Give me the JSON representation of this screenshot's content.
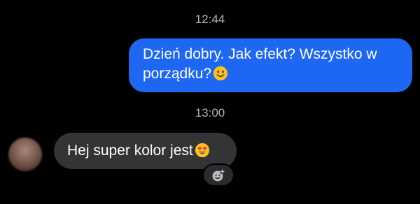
{
  "conversation": {
    "messages": [
      {
        "timestamp": "12:44",
        "direction": "outgoing",
        "text": "Dzień dobry. Jak efekt? Wszystko w porządku?",
        "emoji": "slightly-smiling-face"
      },
      {
        "timestamp": "13:00",
        "direction": "incoming",
        "text": "Hej super kolor jest",
        "emoji": "smiling-face-with-heart-eyes"
      }
    ],
    "reaction_button_icon": "add-reaction-icon"
  },
  "colors": {
    "background": "#000000",
    "outgoing_bubble": "#1d67f2",
    "incoming_bubble": "#333436",
    "timestamp_text": "#b0b3b8",
    "emoji_yellow": "#fcc21b"
  }
}
